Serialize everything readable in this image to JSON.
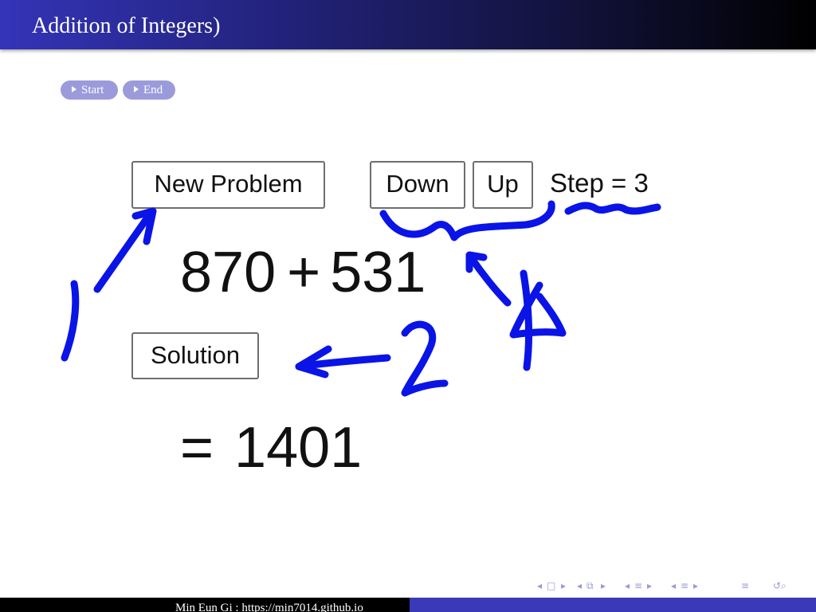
{
  "header": {
    "title": "Addition of Integers)"
  },
  "nav_buttons": {
    "start_label": "Start",
    "end_label": "End"
  },
  "applet": {
    "new_problem_label": "New Problem",
    "down_label": "Down",
    "up_label": "Up",
    "step_text": "Step = 3",
    "operand_a": "870",
    "operator": "+",
    "operand_b": "531",
    "solution_label": "Solution",
    "equals": "=",
    "answer": "1401"
  },
  "annotations": {
    "ink_color": "#0a14e6"
  },
  "beamer_nav": {
    "icons": [
      "frame-nav-icon",
      "subsection-nav-icon",
      "section-nav-icon",
      "part-nav-icon",
      "align-icon",
      "search-icon"
    ]
  },
  "footer": {
    "text": "Min Eun Gi : https://min7014.github.io"
  }
}
